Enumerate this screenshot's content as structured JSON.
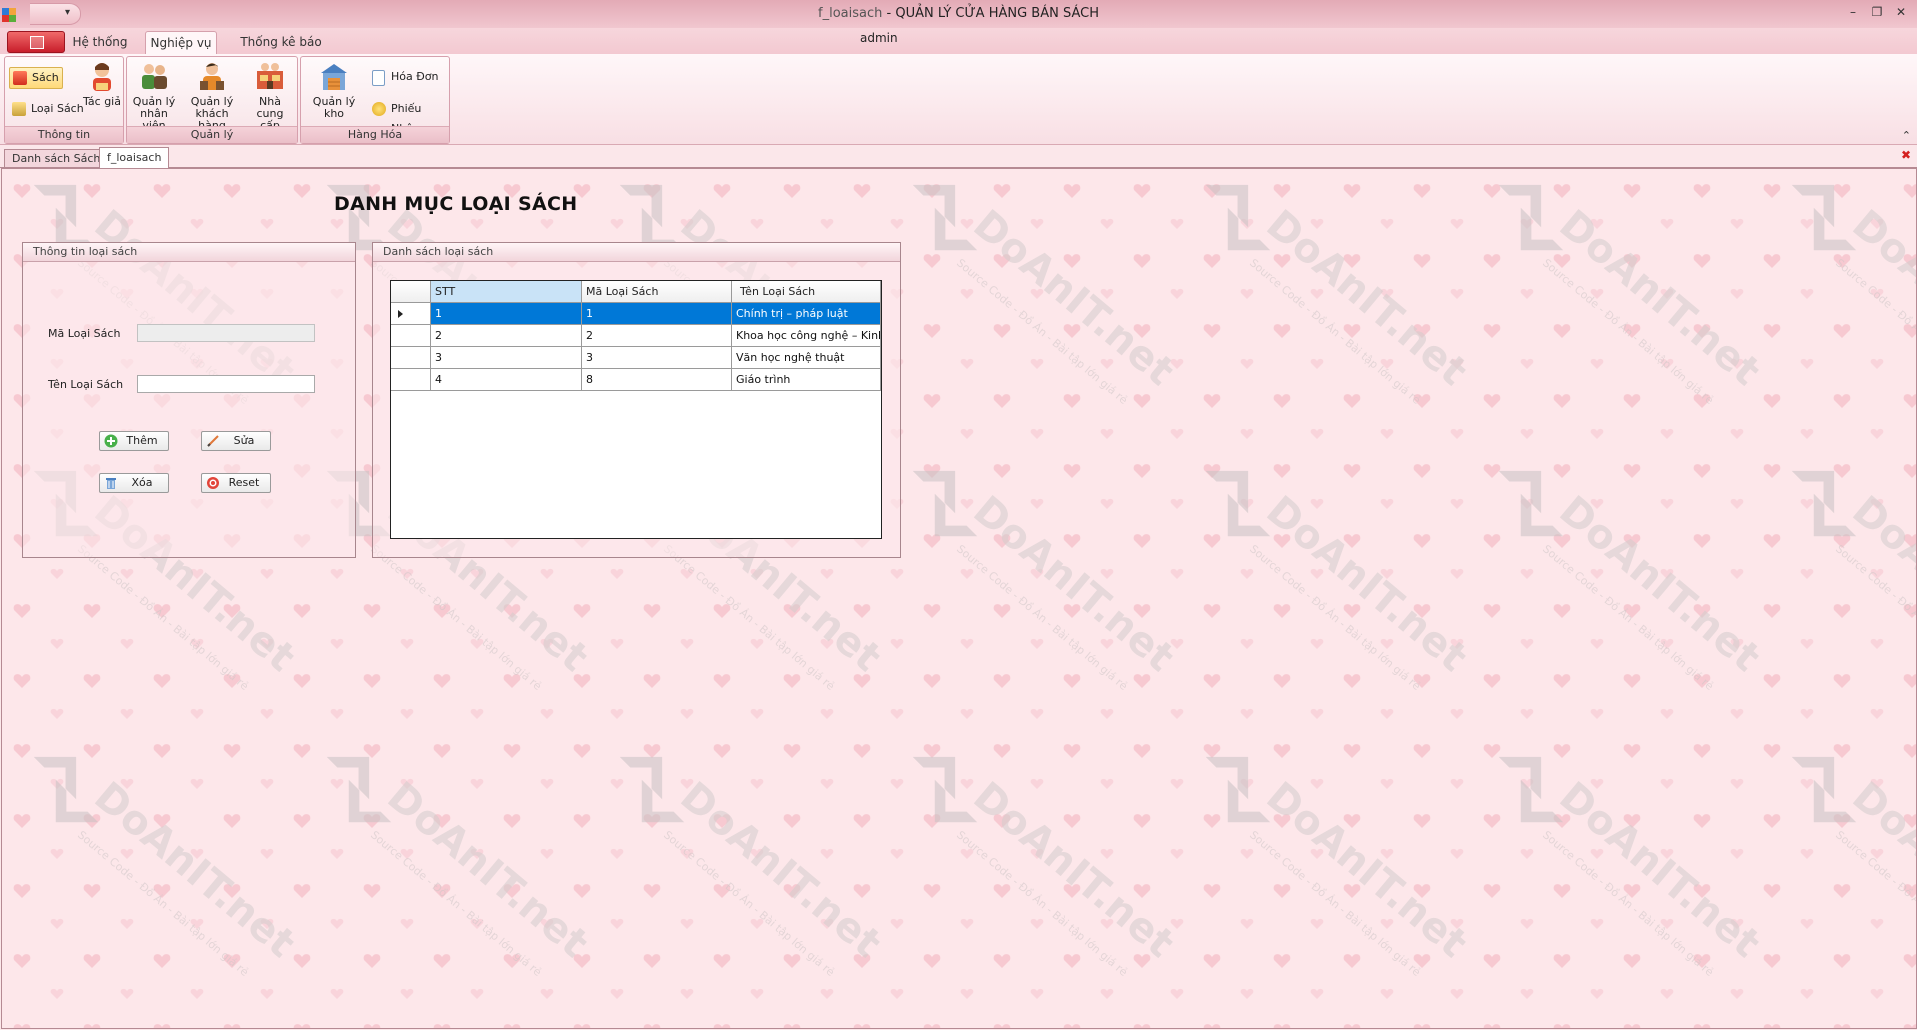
{
  "window": {
    "doc_name": "f_loaisach",
    "title_rest": " - QUẢN LÝ CỬA HÀNG BÁN SÁCH",
    "qat_arrow": "▾",
    "controls": [
      "–",
      "❐",
      "✕"
    ]
  },
  "ribbon": {
    "tabs": [
      {
        "label": "Hệ thống"
      },
      {
        "label": "Nghiệp vụ"
      },
      {
        "label": "Thống kê báo cáo"
      }
    ],
    "user": "admin",
    "groups": {
      "thongtin": {
        "title": "Thông tin",
        "sach": "Sách",
        "loai_sach": "Loại Sách",
        "tac_gia": "Tác giả"
      },
      "quanly": {
        "title": "Quản lý",
        "nhan_vien": [
          "Quản lý",
          "nhân viên"
        ],
        "khach_hang": [
          "Quản lý",
          "khách hàng"
        ],
        "nha_cung_cap": [
          "Nhà cung",
          "cấp"
        ]
      },
      "hanghoa": {
        "title": "Hàng Hóa",
        "quan_ly_kho": "Quản lý kho",
        "hoa_don": "Hóa Đơn",
        "phieu_nhap": "Phiếu Nhập"
      }
    },
    "collapse": "⌃"
  },
  "doc_tabs": [
    {
      "label": "Danh sách Sách"
    },
    {
      "label": "f_loaisach"
    }
  ],
  "doc_close": "✖",
  "form": {
    "heading": "DANH MỤC LOẠI SÁCH",
    "info_group": {
      "title": "Thông tin loại sách",
      "ma_label": "Mã Loại Sách",
      "ma_value": "",
      "ten_label": "Tên Loại Sách",
      "ten_value": "",
      "buttons": {
        "them": "Thêm",
        "sua": "Sửa",
        "xoa": "Xóa",
        "reset": "Reset"
      }
    },
    "list_group": {
      "title": "Danh sách loại sách",
      "columns": [
        "STT",
        "Mã Loại Sách",
        "Tên Loại Sách"
      ],
      "rows": [
        {
          "stt": "1",
          "ma": "1",
          "ten": "Chính trị – pháp luật"
        },
        {
          "stt": "2",
          "ma": "2",
          "ten": "Khoa học công nghệ – Kinh tế"
        },
        {
          "stt": "3",
          "ma": "3",
          "ten": "Văn học nghệ thuật"
        },
        {
          "stt": "4",
          "ma": "8",
          "ten": "Giáo trình"
        }
      ]
    }
  },
  "colors": {
    "selection": "#0078d7",
    "app_button": "#d7232f",
    "background": "#fde7ea"
  }
}
